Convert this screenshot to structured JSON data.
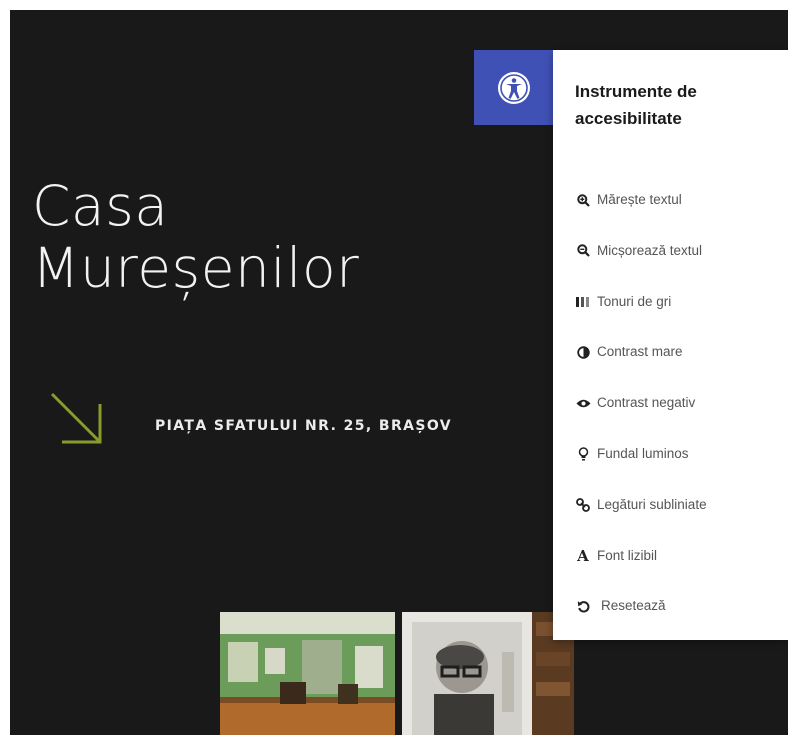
{
  "hero": {
    "title_line1": "Casa",
    "title_line2": "Mureșenilor",
    "address": "PIAȚA SFATULUI NR. 25, BRAȘOV"
  },
  "accessibility": {
    "title": "Instrumente de accesibilitate",
    "toggle_icon": "accessibility-icon",
    "accent_color": "#3f51b5",
    "tools": [
      {
        "icon": "zoom-in-icon",
        "label": "Mărește textul"
      },
      {
        "icon": "zoom-out-icon",
        "label": "Micșorează textul"
      },
      {
        "icon": "grayscale-icon",
        "label": "Tonuri de gri"
      },
      {
        "icon": "contrast-icon",
        "label": "Contrast mare"
      },
      {
        "icon": "eye-icon",
        "label": "Contrast negativ"
      },
      {
        "icon": "lightbulb-icon",
        "label": "Fundal luminos"
      },
      {
        "icon": "link-icon",
        "label": "Legături subliniate"
      },
      {
        "icon": "font-icon",
        "label": "Font lizibil"
      },
      {
        "icon": "reset-icon",
        "label": "Resetează"
      }
    ]
  },
  "colors": {
    "background": "#191919",
    "arrow": "#8a9a2c"
  }
}
